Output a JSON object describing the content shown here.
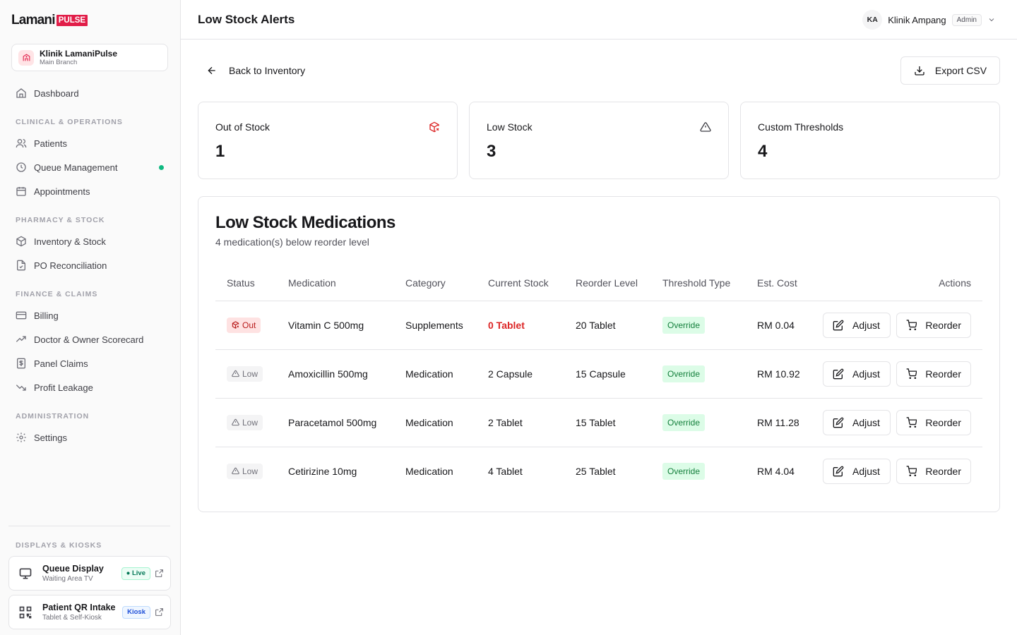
{
  "brand": {
    "name": "Lamani",
    "badge": "PULSE"
  },
  "clinic": {
    "name": "Klinik LamaniPulse",
    "branch": "Main Branch"
  },
  "nav": {
    "dashboard": "Dashboard",
    "sections": {
      "clinical": "CLINICAL & OPERATIONS",
      "pharmacy": "PHARMACY & STOCK",
      "finance": "FINANCE & CLAIMS",
      "admin": "ADMINISTRATION",
      "displays": "DISPLAYS & KIOSKS"
    },
    "items": {
      "patients": "Patients",
      "queue": "Queue Management",
      "appointments": "Appointments",
      "inventory": "Inventory & Stock",
      "po": "PO Reconciliation",
      "billing": "Billing",
      "scorecard": "Doctor & Owner Scorecard",
      "panel": "Panel Claims",
      "leakage": "Profit Leakage",
      "settings": "Settings"
    }
  },
  "kiosks": [
    {
      "title": "Queue Display",
      "sub": "Waiting Area TV",
      "badge": "● Live"
    },
    {
      "title": "Patient QR Intake",
      "sub": "Tablet & Self-Kiosk",
      "badge": "Kiosk"
    }
  ],
  "header": {
    "title": "Low Stock Alerts",
    "initials": "KA",
    "user": "Klinik Ampang",
    "role": "Admin"
  },
  "actions": {
    "back": "Back to Inventory",
    "export": "Export CSV"
  },
  "stats": [
    {
      "label": "Out of Stock",
      "value": "1"
    },
    {
      "label": "Low Stock",
      "value": "3"
    },
    {
      "label": "Custom Thresholds",
      "value": "4"
    }
  ],
  "table": {
    "title": "Low Stock Medications",
    "subtitle": "4 medication(s) below reorder level",
    "headers": [
      "Status",
      "Medication",
      "Category",
      "Current Stock",
      "Reorder Level",
      "Threshold Type",
      "Est. Cost",
      "Actions"
    ],
    "rows": [
      {
        "status": "Out",
        "medication": "Vitamin C 500mg",
        "category": "Supplements",
        "current": "0 Tablet",
        "reorder": "20 Tablet",
        "threshold": "Override",
        "cost": "RM 0.04"
      },
      {
        "status": "Low",
        "medication": "Amoxicillin 500mg",
        "category": "Medication",
        "current": "2 Capsule",
        "reorder": "15 Capsule",
        "threshold": "Override",
        "cost": "RM 10.92"
      },
      {
        "status": "Low",
        "medication": "Paracetamol 500mg",
        "category": "Medication",
        "current": "2 Tablet",
        "reorder": "15 Tablet",
        "threshold": "Override",
        "cost": "RM 11.28"
      },
      {
        "status": "Low",
        "medication": "Cetirizine 10mg",
        "category": "Medication",
        "current": "4 Tablet",
        "reorder": "25 Tablet",
        "threshold": "Override",
        "cost": "RM 4.04"
      }
    ],
    "adjust": "Adjust",
    "reorder": "Reorder"
  },
  "colors": {
    "brand": "#e11d48",
    "danger": "#dc2626",
    "success": "#15803d",
    "live": "#10b981"
  }
}
